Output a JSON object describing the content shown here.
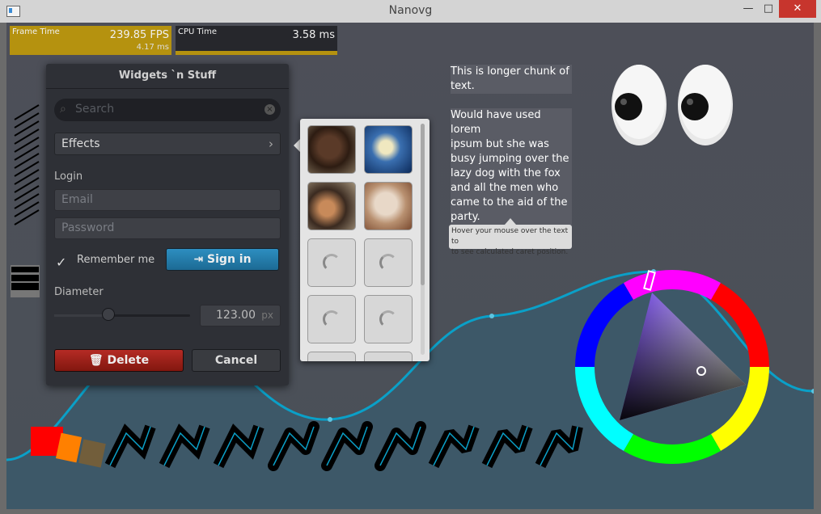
{
  "window": {
    "title": "Nanovg",
    "minimize": "—",
    "maximize": "□",
    "close": "✕"
  },
  "graphs": {
    "frame": {
      "name": "Frame Time",
      "value": "239.85 FPS",
      "sub": "4.17 ms",
      "color": "#b5920f"
    },
    "cpu": {
      "name": "CPU Time",
      "value": "3.58 ms",
      "color": "#b5920f"
    }
  },
  "panel": {
    "title": "Widgets `n Stuff",
    "search_placeholder": "Search",
    "search_icon": "search-icon",
    "clear_icon": "×",
    "effects_label": "Effects",
    "effects_chevron": "›",
    "login_label": "Login",
    "email_placeholder": "Email",
    "password_placeholder": "Password",
    "remember_checked": true,
    "remember_check_glyph": "✓",
    "remember_label": "Remember me",
    "signin_icon": "⇥",
    "signin_label": "Sign in",
    "diameter_label": "Diameter",
    "slider_value": 0.4,
    "diameter_value": "123.00",
    "diameter_unit": "px",
    "delete_icon": "🗑",
    "delete_label": "Delete",
    "cancel_label": "Cancel"
  },
  "thumbnails": {
    "items": [
      {
        "kind": "image",
        "name": "dog-thumbnail"
      },
      {
        "kind": "image",
        "name": "jellyfish-thumbnail"
      },
      {
        "kind": "image",
        "name": "rodent-thumbnail"
      },
      {
        "kind": "image",
        "name": "rabbit-thumbnail"
      },
      {
        "kind": "loading",
        "name": "loading-thumbnail"
      },
      {
        "kind": "loading",
        "name": "loading-thumbnail"
      },
      {
        "kind": "loading",
        "name": "loading-thumbnail"
      },
      {
        "kind": "loading",
        "name": "loading-thumbnail"
      },
      {
        "kind": "loading",
        "name": "loading-thumbnail"
      },
      {
        "kind": "loading",
        "name": "loading-thumbnail"
      }
    ]
  },
  "paragraph": {
    "lines": [
      "This is longer chunk of",
      "text.",
      "",
      "Would have used lorem",
      "ipsum but she    was",
      "busy jumping over the",
      "lazy dog with the fox",
      "and all the men who",
      "came to the aid of the",
      "party."
    ]
  },
  "tooltip": {
    "line1": "Hover your mouse over the text to",
    "line2": "to see calculated caret position."
  },
  "colors": {
    "accent": "#0a9ec8",
    "signin": "#2d8ec0",
    "delete": "#b52b25",
    "curve": "#0aa0c8"
  },
  "color_wheel": {
    "hue_marker": "selected-hue",
    "picker": "saturation-value-picker"
  }
}
